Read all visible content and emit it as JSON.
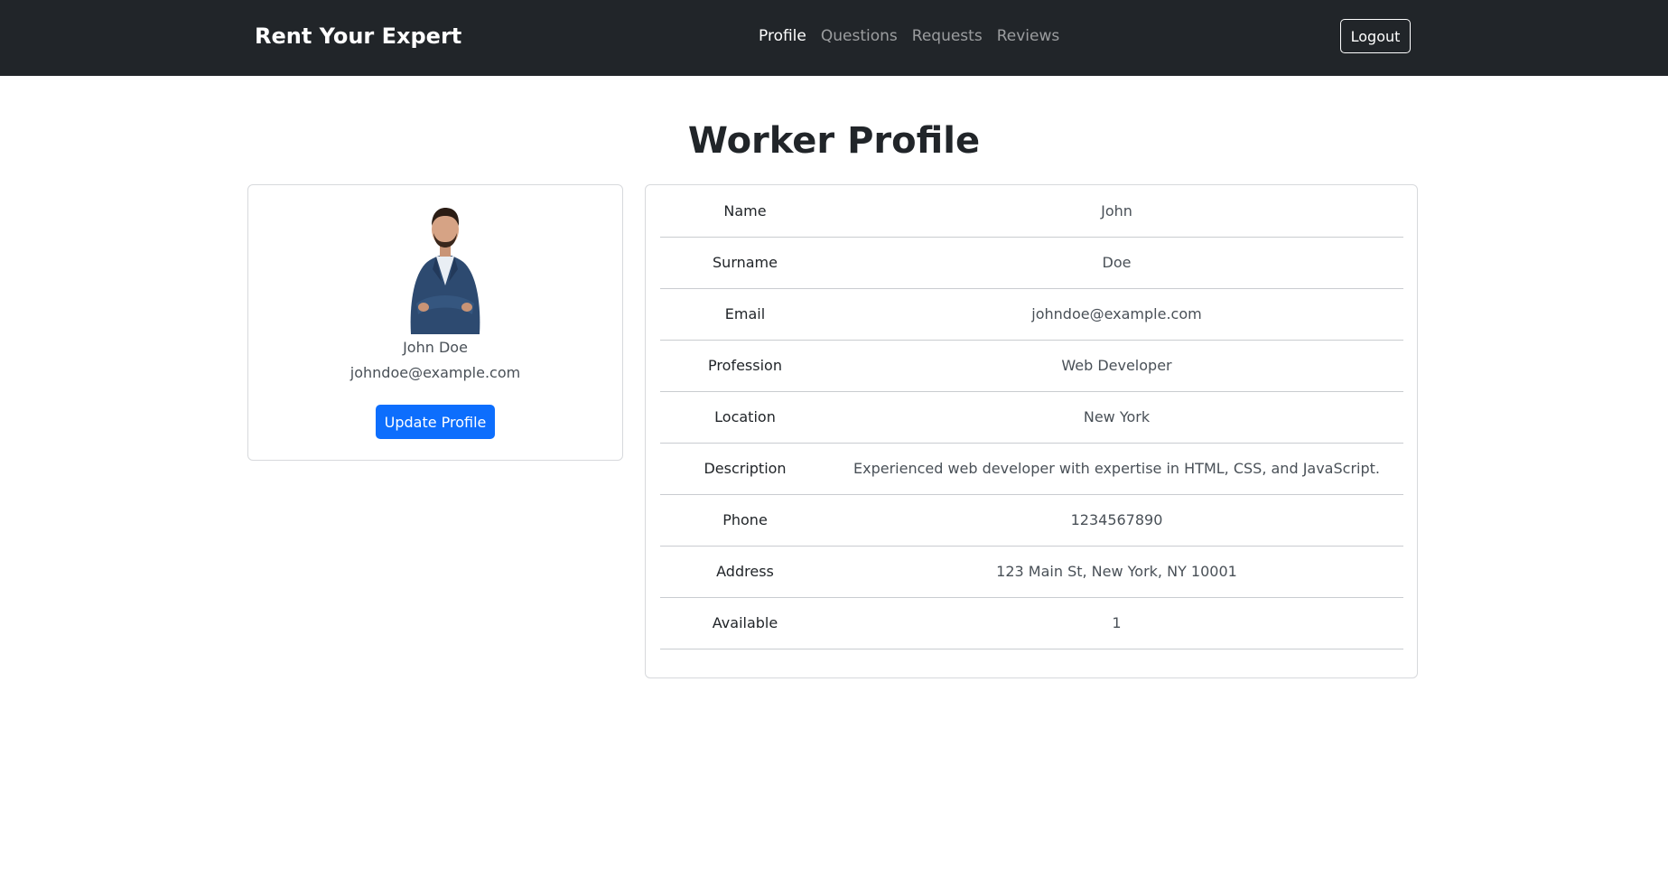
{
  "nav": {
    "brand": "Rent Your Expert",
    "links": [
      {
        "label": "Profile",
        "active": true
      },
      {
        "label": "Questions",
        "active": false
      },
      {
        "label": "Requests",
        "active": false
      },
      {
        "label": "Reviews",
        "active": false
      }
    ],
    "logout_label": "Logout"
  },
  "page": {
    "title": "Worker Profile"
  },
  "profile_card": {
    "name": "John Doe",
    "email": "johndoe@example.com",
    "update_label": "Update Profile",
    "avatar_icon": "person-photo-icon"
  },
  "details": [
    {
      "label": "Name",
      "value": "John"
    },
    {
      "label": "Surname",
      "value": "Doe"
    },
    {
      "label": "Email",
      "value": "johndoe@example.com"
    },
    {
      "label": "Profession",
      "value": "Web Developer"
    },
    {
      "label": "Location",
      "value": "New York"
    },
    {
      "label": "Description",
      "value": "Experienced web developer with expertise in HTML, CSS, and JavaScript."
    },
    {
      "label": "Phone",
      "value": "1234567890"
    },
    {
      "label": "Address",
      "value": "123 Main St, New York, NY 10001"
    },
    {
      "label": "Available",
      "value": "1"
    }
  ],
  "colors": {
    "navbar_bg": "#212529",
    "primary": "#0d6efd",
    "nav_inactive": "rgba(255,255,255,0.55)"
  }
}
